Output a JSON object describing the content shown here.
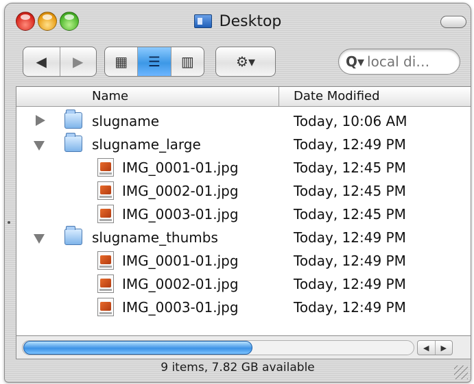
{
  "window": {
    "title": "Desktop"
  },
  "toolbar": {
    "back_icon": "◀",
    "forward_icon": "▶",
    "view_icons": [
      "▦",
      "☰",
      "▥"
    ],
    "action_icon": "⚙▾",
    "search_icon": "Q▾",
    "search_placeholder": "local di…"
  },
  "columns": {
    "name": "Name",
    "date": "Date Modified"
  },
  "rows": [
    {
      "name": "slugname",
      "date": "Today, 10:06 AM"
    },
    {
      "name": "slugname_large",
      "date": "Today, 12:49 PM"
    },
    {
      "name": "IMG_0001-01.jpg",
      "date": "Today, 12:45 PM"
    },
    {
      "name": "IMG_0002-01.jpg",
      "date": "Today, 12:45 PM"
    },
    {
      "name": "IMG_0003-01.jpg",
      "date": "Today, 12:45 PM"
    },
    {
      "name": "slugname_thumbs",
      "date": "Today, 12:49 PM"
    },
    {
      "name": "IMG_0001-01.jpg",
      "date": "Today, 12:49 PM"
    },
    {
      "name": "IMG_0002-01.jpg",
      "date": "Today, 12:49 PM"
    },
    {
      "name": "IMG_0003-01.jpg",
      "date": "Today, 12:49 PM"
    }
  ],
  "scrollbar": {
    "left_icon": "◀",
    "right_icon": "▶"
  },
  "status": "9 items, 7.82 GB available",
  "colors": {
    "selection_blue": "#3d98e6",
    "folder_blue": "#7fb4ea",
    "jpg_orange": "#e86a2a"
  }
}
